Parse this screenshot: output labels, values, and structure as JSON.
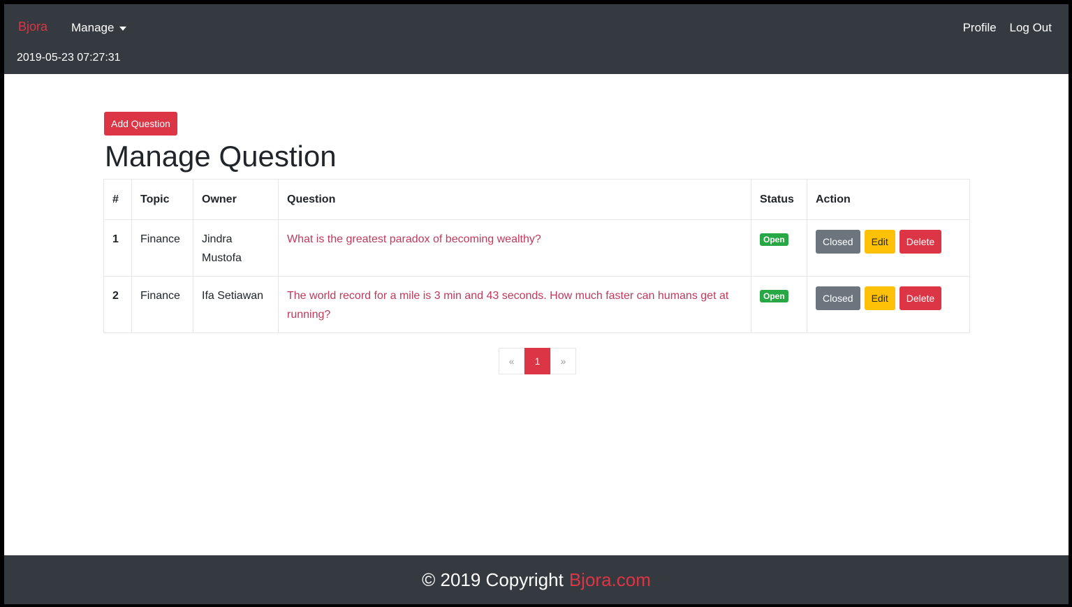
{
  "nav": {
    "brand": "Bjora",
    "manage_label": "Manage",
    "datetime": "2019-05-23 07:27:31",
    "profile": "Profile",
    "logout": "Log Out"
  },
  "main": {
    "add_button": "Add Question",
    "title": "Manage Question",
    "table": {
      "headers": [
        "#",
        "Topic",
        "Owner",
        "Question",
        "Status",
        "Action"
      ],
      "rows": [
        {
          "num": "1",
          "topic": "Finance",
          "owner": "Jindra Mustofa",
          "question": "What is the greatest paradox of becoming wealthy?",
          "status": "Open",
          "closed": "Closed",
          "edit": "Edit",
          "delete": "Delete"
        },
        {
          "num": "2",
          "topic": "Finance",
          "owner": "Ifa Setiawan",
          "question": "The world record for a mile is 3 min and 43 seconds. How much faster can humans get at running?",
          "status": "Open",
          "closed": "Closed",
          "edit": "Edit",
          "delete": "Delete"
        }
      ]
    },
    "pagination": {
      "prev": "«",
      "current": "1",
      "next": "»"
    }
  },
  "footer": {
    "text": "© 2019 Copyright",
    "link": "Bjora.com"
  },
  "colors": {
    "navbar": "#343a40",
    "accent": "#dc3545",
    "open_badge": "#28a745",
    "edit": "#ffc107",
    "closed": "#6c757d"
  }
}
